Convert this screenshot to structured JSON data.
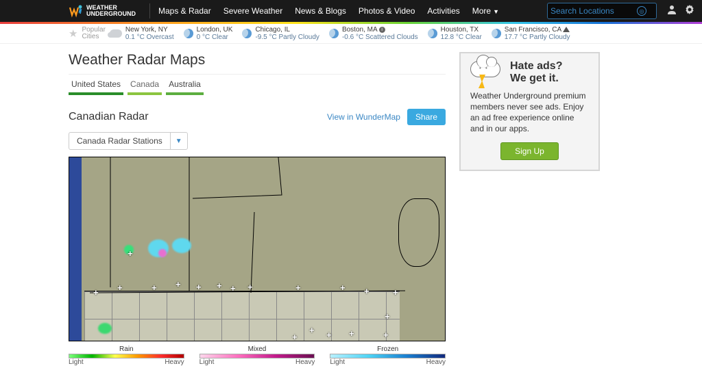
{
  "brand1": "WEATHER",
  "brand2": "UNDERGROUND",
  "nav": {
    "maps": "Maps & Radar",
    "severe": "Severe Weather",
    "news": "News & Blogs",
    "photos": "Photos & Video",
    "act": "Activities",
    "more": "More"
  },
  "search": {
    "placeholder": "Search Locations"
  },
  "pop1": "Popular",
  "pop2": "Cities",
  "cities": {
    "nyc": {
      "n": "New York, NY",
      "c": "0.1 °C Overcast"
    },
    "lon": {
      "n": "London, UK",
      "c": "0 °C Clear"
    },
    "chi": {
      "n": "Chicago, IL",
      "c": "-9.5 °C Partly Cloudy"
    },
    "bos": {
      "n": "Boston, MA",
      "c": "-0.6 °C Scattered Clouds"
    },
    "hou": {
      "n": "Houston, TX",
      "c": "12.8 °C Clear"
    },
    "sf": {
      "n": "San Francisco, CA",
      "c": "17.7 °C Partly Cloudy"
    }
  },
  "page_title": "Weather Radar Maps",
  "tabs": {
    "us": "United States",
    "ca": "Canada",
    "au": "Australia"
  },
  "sub_title": "Canadian Radar",
  "view_link": "View in WunderMap",
  "share": "Share",
  "dropdown": "Canada Radar Stations",
  "legend": {
    "rain": "Rain",
    "mixed": "Mixed",
    "frozen": "Frozen",
    "light": "Light",
    "heavy": "Heavy"
  },
  "ad": {
    "h1": "Hate ads?",
    "h2": "We get it.",
    "body": "Weather Underground premium members never see ads. Enjoy an ad free experience online and in our apps.",
    "btn": "Sign Up"
  }
}
